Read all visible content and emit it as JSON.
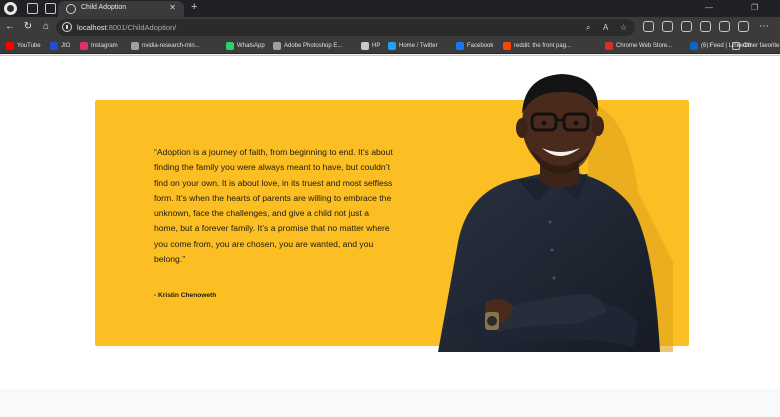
{
  "browser": {
    "tab": {
      "title": "Child Adoption"
    },
    "address": {
      "host": "localhost",
      "rest": ":8001/ChildAdoption/"
    },
    "bookmarks": [
      {
        "label": "YouTube",
        "icon": "youtube-icon",
        "color": "#ff0000"
      },
      {
        "label": "JIO",
        "icon": "jio-icon",
        "color": "#1f4fd6"
      },
      {
        "label": "Instagram",
        "icon": "instagram-icon",
        "color": "#e1306c"
      },
      {
        "label": "nvidia-research-min...",
        "icon": "globe-icon",
        "color": "#9aa0a6"
      },
      {
        "label": "WhatsApp",
        "icon": "whatsapp-icon",
        "color": "#25d366"
      },
      {
        "label": "Adobe Photoshop E...",
        "icon": "globe-icon",
        "color": "#9aa0a6"
      },
      {
        "label": "HP",
        "icon": "folder-icon",
        "color": "#c8c8c8"
      },
      {
        "label": "Home / Twitter",
        "icon": "twitter-icon",
        "color": "#1da1f2"
      },
      {
        "label": "Facebook",
        "icon": "facebook-icon",
        "color": "#1877f2"
      },
      {
        "label": "reddit: the front pag...",
        "icon": "reddit-icon",
        "color": "#ff4500"
      },
      {
        "label": "Chrome Web Store...",
        "icon": "chrome-store-icon",
        "color": "#d93025"
      },
      {
        "label": "(6) Feed | LinkedIn",
        "icon": "linkedin-icon",
        "color": "#0a66c2"
      }
    ],
    "other_favorites": "Other favorite"
  },
  "testimonial": {
    "quote": "“Adoption is a journey of faith, from beginning to end. It’s about finding the family you were always meant to have, but couldn’t find on your own. It is about love, in its truest and most selfless form. It’s when the hearts of parents are willing to embrace the unknown, face the challenges, and give a child not just a home, but a forever family. It’s a promise that no matter where you come from, you are chosen, you are wanted, and you belong.”",
    "author": "- Kristin Chenoweth"
  },
  "colors": {
    "card": "#fbbf24",
    "text": "#1f1a10",
    "browser_dark": "#3b3b3b"
  }
}
